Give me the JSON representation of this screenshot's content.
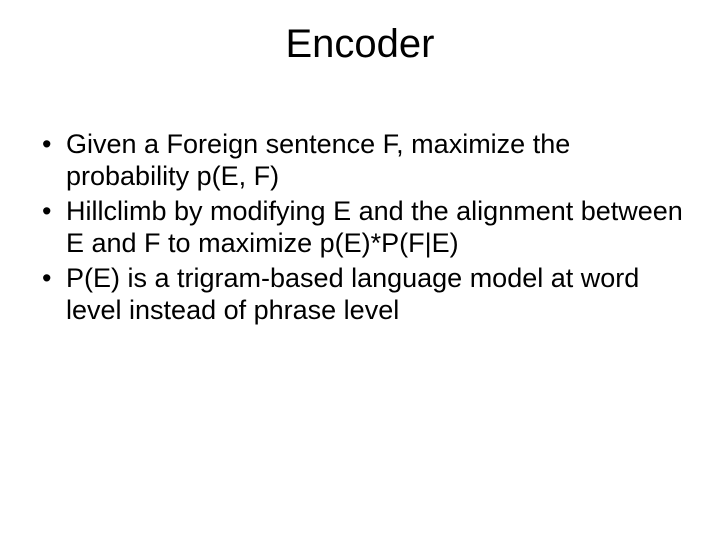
{
  "slide": {
    "title": "Encoder",
    "bullets": [
      "Given a Foreign sentence F, maximize the probability p(E, F)",
      "Hillclimb by modifying E and the alignment between E and F to maximize p(E)*P(F|E)",
      "P(E) is a trigram-based language model at word level instead of phrase level"
    ]
  }
}
